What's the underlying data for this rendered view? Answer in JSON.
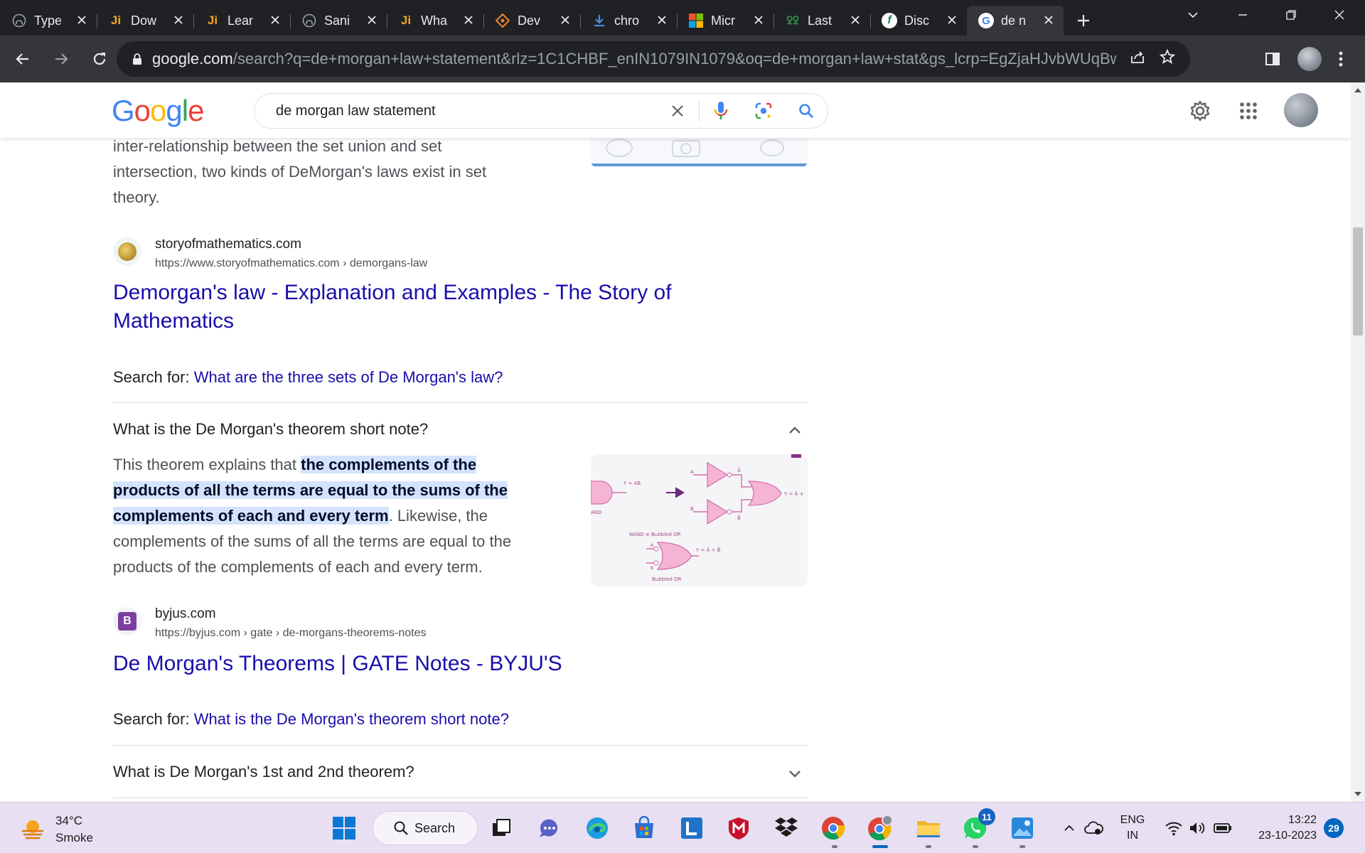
{
  "browser": {
    "tabs": [
      {
        "title": "Type",
        "icon": "github-icon"
      },
      {
        "title": "Dow",
        "icon": "js-icon"
      },
      {
        "title": "Lear",
        "icon": "js-icon"
      },
      {
        "title": "Sani",
        "icon": "github-icon"
      },
      {
        "title": "Wha",
        "icon": "js-icon"
      },
      {
        "title": "Dev",
        "icon": "devfolio-icon"
      },
      {
        "title": "chro",
        "icon": "download-icon"
      },
      {
        "title": "Micr",
        "icon": "microsoft-icon"
      },
      {
        "title": "Last",
        "icon": "gfg-icon"
      },
      {
        "title": "Disc",
        "icon": "disc-icon"
      },
      {
        "title": "de n",
        "icon": "google-icon",
        "active": true
      }
    ],
    "url_host": "google.com",
    "url_path": "/search?q=de+morgan+law+statement&rlz=1C1CHBF_enIN1079IN1079&oq=de+morgan+law+stat&gs_lcrp=EgZjaHJvbWUqBwgBEAAYgAQ..."
  },
  "google": {
    "logo": [
      "G",
      "o",
      "o",
      "g",
      "l",
      "e"
    ],
    "query": "de morgan law statement"
  },
  "results": {
    "top_para_lines": [
      "inter-relationship between the set union and set",
      "intersection, two kinds of DeMorgan's laws exist in set",
      "theory."
    ],
    "r1": {
      "site_name": "storyofmathematics.com",
      "site_url": "https://www.storyofmathematics.com › demorgans-law",
      "title_line1": "Demorgan's law - Explanation and Examples - The Story of",
      "title_line2": "Mathematics",
      "search_for_label": "Search for:",
      "search_for_link": "What are the three sets of De Morgan's law?"
    },
    "faq1": {
      "question": "What is the De Morgan's theorem short note?",
      "text_pre": "This theorem explains that ",
      "hl1": "the complements of the",
      "hl2": "products of all the terms are equal to the sums of the",
      "hl3": "complements of each and every term",
      "text_post1": ". Likewise, the",
      "line4": "complements of the sums of all the terms are equal to the",
      "line5": "products of the complements of each and every term.",
      "img_labels": {
        "y_ab": "Y = AB",
        "a": "A",
        "b": "B",
        "abar": "Ā",
        "bbar": "B̄",
        "y_out": "Y = Ā +",
        "nand_left": "AND",
        "nand_eq": "NAND ≡ Bubbled OR",
        "y_sum": "Y = Ā + B̄",
        "bubbled_or": "Bubbled OR"
      }
    },
    "r2": {
      "site_name": "byjus.com",
      "site_url": "https://byjus.com › gate › de-morgans-theorems-notes",
      "title": "De Morgan's Theorems | GATE Notes - BYJU'S",
      "search_for_label": "Search for:",
      "search_for_link": "What is the De Morgan's theorem short note?"
    },
    "faq2": {
      "question": "What is De Morgan's 1st and 2nd theorem?"
    }
  },
  "taskbar": {
    "weather_temp": "34°C",
    "weather_desc": "Smoke",
    "search_label": "Search",
    "whatsapp_badge": "11",
    "lang_line1": "ENG",
    "lang_line2": "IN",
    "time": "13:22",
    "date": "23-10-2023",
    "notifications": "29"
  },
  "colors": {
    "link": "#1a0dab",
    "highlight": "#d3e3fd",
    "chrome_dark": "#202124",
    "chrome_toolbar": "#35363a"
  }
}
